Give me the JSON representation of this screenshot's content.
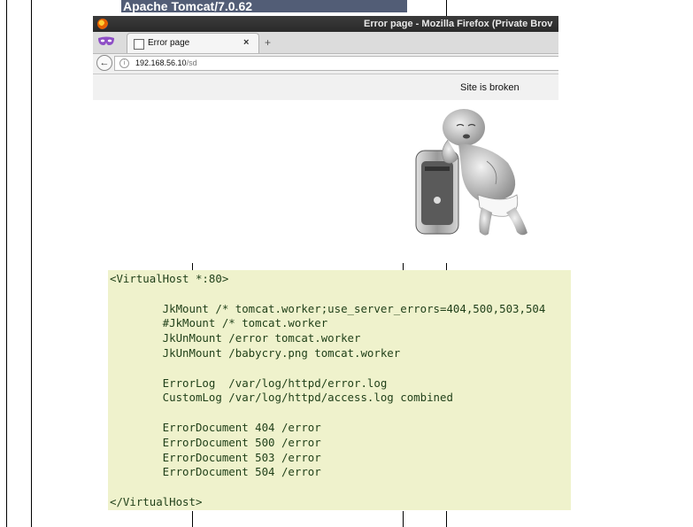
{
  "banner": {
    "text": "Apache Tomcat/7.0.62"
  },
  "browser": {
    "window_title": "Error page - Mozilla Firefox (Private Brov",
    "tab_label": "Error page",
    "tab_close": "×",
    "new_tab": "+",
    "back": "←",
    "info": "i",
    "url_host": "192.168.56.10",
    "url_path": "/sd",
    "page_message": "Site is broken"
  },
  "image": {
    "name": "crying-baby-with-computer"
  },
  "code": {
    "lines": [
      "<VirtualHost *:80>",
      "",
      "        JkMount /* tomcat.worker;use_server_errors=404,500,503,504",
      "        #JkMount /* tomcat.worker",
      "        JkUnMount /error tomcat.worker",
      "        JkUnMount /babycry.png tomcat.worker",
      "",
      "        ErrorLog  /var/log/httpd/error.log",
      "        CustomLog /var/log/httpd/access.log combined",
      "",
      "        ErrorDocument 404 /error",
      "        ErrorDocument 500 /error",
      "        ErrorDocument 503 /error",
      "        ErrorDocument 504 /error",
      "",
      "</VirtualHost>"
    ]
  },
  "colors": {
    "banner_bg": "#525d76",
    "code_bg": "#eff2cc",
    "code_text": "#1f3f18"
  }
}
